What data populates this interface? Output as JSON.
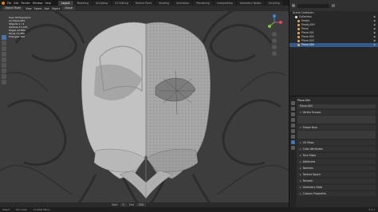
{
  "topbar": {
    "menus": [
      "File",
      "Edit",
      "Render",
      "Window",
      "Help"
    ],
    "tabs": [
      "Layout",
      "Modeling",
      "Sculpting",
      "UV Editing",
      "Texture Paint",
      "Shading",
      "Animation",
      "Rendering",
      "Compositing",
      "Geometry Nodes",
      "Scripting"
    ],
    "active_tab": "Layout",
    "scene": "Scene",
    "view_layer": "ViewLayer"
  },
  "header2": {
    "items": [
      "Object Mode",
      "View",
      "Select",
      "Add",
      "Object",
      "Global"
    ]
  },
  "overlay_stats": [
    "User Orthographic",
    "(1) Plane.004",
    "Objects  1 / 4",
    "Vertices  11,474",
    "Edges  22,860",
    "Faces  11,389",
    "Triangles  768"
  ],
  "outliner": {
    "items": [
      {
        "label": "Scene Collection",
        "selected": false
      },
      {
        "label": "Collection",
        "selected": false
      },
      {
        "label": "Empty",
        "selected": false
      },
      {
        "label": "Empty.001",
        "selected": false
      },
      {
        "label": "Plane",
        "selected": false
      },
      {
        "label": "Plane.001",
        "selected": false
      },
      {
        "label": "Plane.002",
        "selected": false
      },
      {
        "label": "Plane.003",
        "selected": false
      },
      {
        "label": "Plane.004",
        "selected": true
      }
    ]
  },
  "properties": {
    "object_name": "Plane.004",
    "mesh_field": "Plane.004",
    "panels": [
      "Vertex Groups",
      "Shape Keys",
      "UV Maps",
      "Color Attributes",
      "Face Maps",
      "Attributes",
      "Normals",
      "Texture Space",
      "Remesh",
      "Geometry Data",
      "Custom Properties"
    ]
  },
  "timeline": {
    "start_label": "Start",
    "start": "1",
    "end_label": "End",
    "end": "250"
  },
  "statusbar": {
    "left": "Select",
    "middle": "Pan View",
    "right": "Context Menu",
    "version": "3.3.1"
  },
  "colors": {
    "accent": "#4772b3",
    "selection": "#335a8c",
    "viewport_bg": "#3d3d3d",
    "mesh_light": "#c4c4c4",
    "mesh_dark": "#6a6a6a"
  }
}
